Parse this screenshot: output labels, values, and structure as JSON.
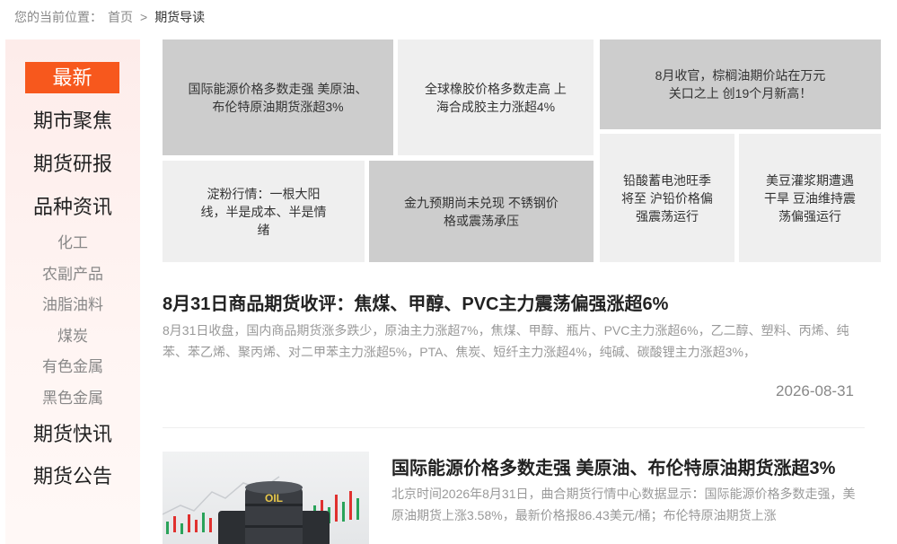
{
  "breadcrumb": {
    "prefix": "您的当前位置：",
    "home": "首页",
    "separator": ">",
    "current": "期货导读"
  },
  "sidebar": {
    "active": "最新",
    "items": [
      "期市聚焦",
      "期货研报",
      "品种资讯"
    ],
    "sub_items": [
      "化工",
      "农副产品",
      "油脂油料",
      "煤炭",
      "有色金属",
      "黑色金属"
    ],
    "bottom_items": [
      "期货快讯",
      "期货公告"
    ]
  },
  "tiles": [
    "国际能源价格多数走强 美原油、布伦特原油期货涨超3%",
    "全球橡胶价格多数走高 上海合成胶主力涨超4%",
    "8月收官，棕榈油期价站在万元关口之上 创19个月新高！",
    "淀粉行情：一根大阳线，半是成本、半是情绪",
    "金九预期尚未兑现 不锈钢价格或震荡承压",
    "铅酸蓄电池旺季将至 沪铅价格偏强震荡运行",
    "美豆灌浆期遭遇干旱 豆油维持震荡偏强运行"
  ],
  "articles": [
    {
      "title": "8月31日商品期货收评：焦煤、甲醇、PVC主力震荡偏强涨超6%",
      "summary": "8月31日收盘，国内商品期货涨多跌少，原油主力涨超7%，焦煤、甲醇、瓶片、PVC主力涨超6%，乙二醇、塑料、丙烯、纯苯、苯乙烯、聚丙烯、对二甲苯主力涨超5%，PTA、焦炭、短纤主力涨超4%，纯碱、碳酸锂主力涨超3%，",
      "date": "2026-08-31"
    },
    {
      "title": "国际能源价格多数走强 美原油、布伦特原油期货涨超3%",
      "summary": "北京时间2026年8月31日，曲合期货行情中心数据显示：国际能源价格多数走强，美原油期货上涨3.58%，最新价格报86.43美元/桶；布伦特原油期货上涨",
      "image_label": "OIL"
    }
  ]
}
